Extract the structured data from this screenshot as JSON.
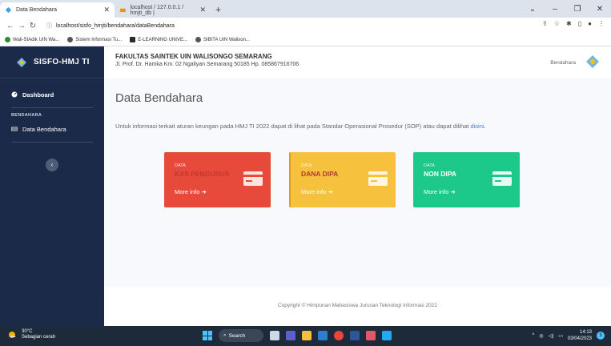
{
  "browser": {
    "tabs": [
      {
        "title": "Data Bendahara",
        "active": true
      },
      {
        "title": "localhost / 127.0.0.1 / hmjti_db |",
        "active": false
      }
    ],
    "url": "localhost/sisfo_hmjti/bendahara/dataBendahara",
    "bookmarks": [
      "Wali-SIAdik UIN Wa...",
      "Sistem Informasi Tu...",
      "E-LEARNING UNIVE...",
      "SIBITA UIN Walison..."
    ],
    "new_tab": "+"
  },
  "sidebar": {
    "brand": "SISFO-HMJ TI",
    "dashboard_label": "Dashboard",
    "section_heading": "BENDAHARA",
    "data_bendahara_label": "Data Bendahara",
    "toggle_glyph": "‹"
  },
  "header": {
    "faculty": "FAKULTAS SAINTEK UIN WALISONGO SEMARANG",
    "address": "Jl. Prof. Dr. Hamka Km. 02 Ngaliyan Semarang 50185 Hp. 085867916706",
    "role": "Bendahara"
  },
  "main": {
    "title": "Data Bendahara",
    "info_text": "Untuk informasi terkait aturan keungan pada HMJ TI 2022 dapat di lihat pada Standar Operasional Prosedur (SOP) atau dapat dilihat",
    "info_link": "disini",
    "info_end": ".",
    "cards": [
      {
        "label": "DATA",
        "value": "KAS PENGURUS",
        "more": "More info",
        "color": "#e74a3b"
      },
      {
        "label": "DATA",
        "value": "DANA DIPA",
        "more": "More info",
        "color": "#f6c23e"
      },
      {
        "label": "DATA",
        "value": "NON DIPA",
        "more": "More info",
        "color": "#1cc88a"
      }
    ]
  },
  "footer": {
    "text": "Copyright © Himpunan Mahasiswa Jurusan Teknologi Informasi 2022"
  },
  "taskbar": {
    "temperature": "30°C",
    "weather": "Sebagian cerah",
    "search": "Search",
    "time": "14:13",
    "date": "03/04/2023",
    "notification_count": "1"
  }
}
